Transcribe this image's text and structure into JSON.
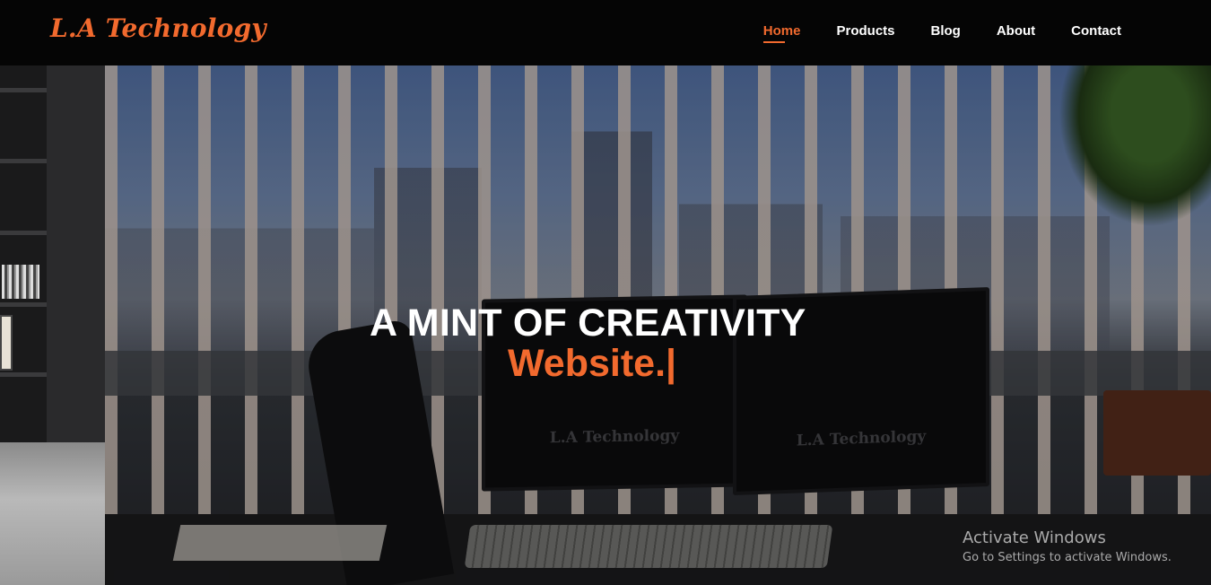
{
  "brand": {
    "name": "L.A Technology"
  },
  "nav": {
    "items": [
      {
        "label": "Home",
        "active": true
      },
      {
        "label": "Products",
        "active": false
      },
      {
        "label": "Blog",
        "active": false
      },
      {
        "label": "About",
        "active": false
      },
      {
        "label": "Contact",
        "active": false
      }
    ]
  },
  "hero": {
    "headline": "A MINT OF CREATIVITY",
    "typed_text": "Website.|",
    "monitor_logo": "L.A Technology"
  },
  "watermark": {
    "title": "Activate Windows",
    "subtitle": "Go to Settings to activate Windows."
  },
  "colors": {
    "accent": "#f26a2e",
    "navbar": "#050505",
    "text": "#ffffff"
  }
}
